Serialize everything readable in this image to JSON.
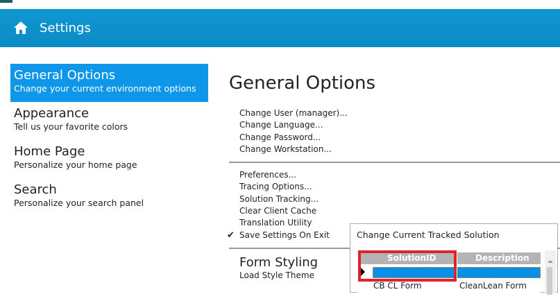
{
  "header": {
    "title": "Settings"
  },
  "nav": [
    {
      "title": "General Options",
      "subtitle": "Change your current environment options"
    },
    {
      "title": "Appearance",
      "subtitle": "Tell us your favorite colors"
    },
    {
      "title": "Home Page",
      "subtitle": "Personalize your home page"
    },
    {
      "title": "Search",
      "subtitle": "Personalize your search panel"
    }
  ],
  "main": {
    "title": "General Options",
    "group1": [
      "Change User (manager)...",
      "Change Language...",
      "Change Password...",
      "Change Workstation..."
    ],
    "group2": [
      "Preferences...",
      "Tracing Options...",
      "Solution Tracking...",
      "Clear Client Cache",
      "Translation Utility",
      "Save Settings On Exit"
    ],
    "section2": "Form Styling",
    "group3": [
      "Load Style Theme"
    ]
  },
  "dialog": {
    "title": "Change Current Tracked Solution",
    "columns": [
      "SolutionID",
      "Description"
    ],
    "row2": [
      "CB CL Form",
      "CleanLean Form"
    ]
  }
}
